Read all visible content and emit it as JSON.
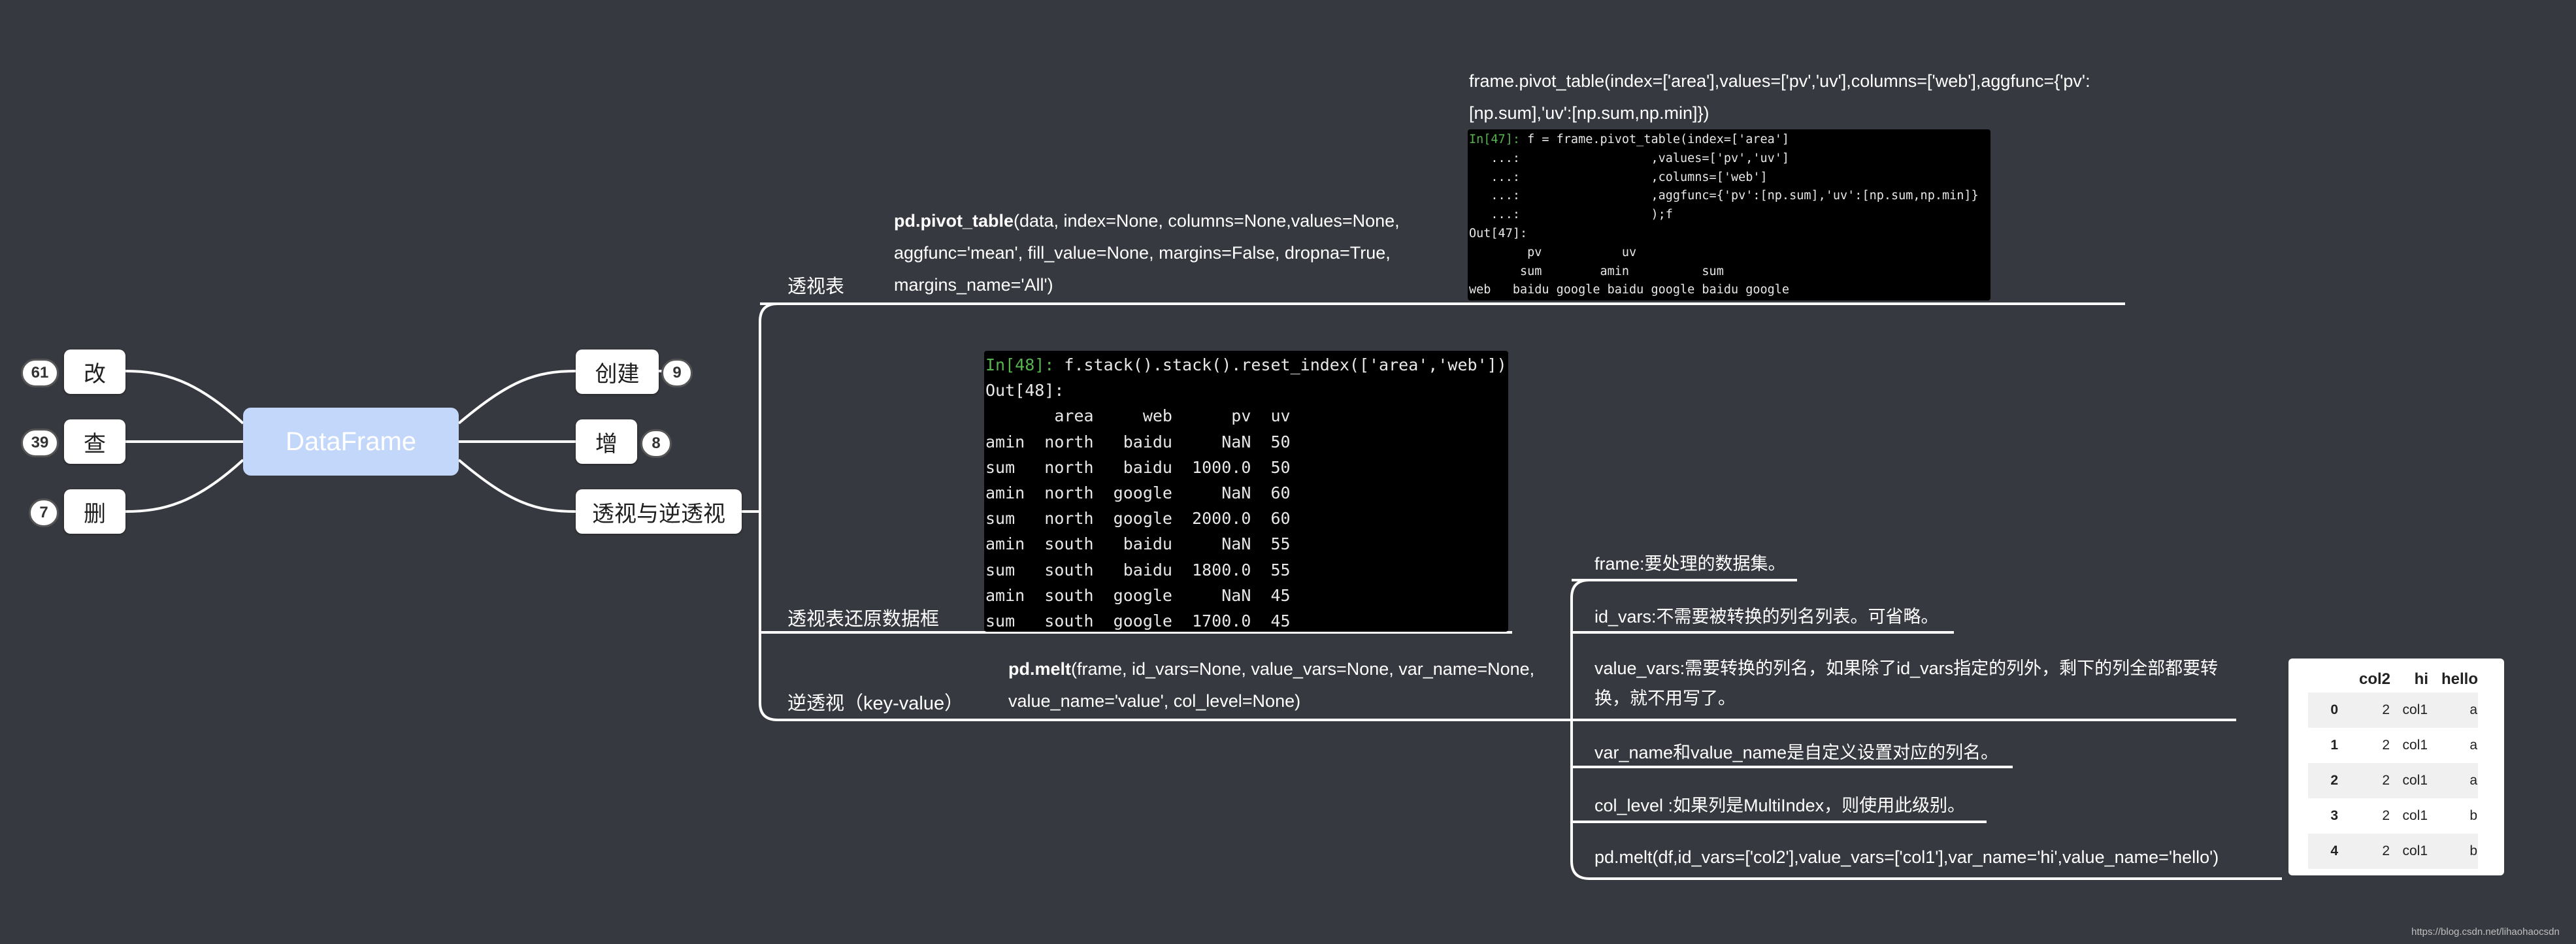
{
  "root": {
    "label": "DataFrame"
  },
  "left_nodes": [
    {
      "label": "改",
      "count": "61"
    },
    {
      "label": "查",
      "count": "39"
    },
    {
      "label": "删",
      "count": "7"
    }
  ],
  "right_nodes": [
    {
      "label": "创建",
      "count": "9"
    },
    {
      "label": "增",
      "count": "8"
    },
    {
      "label": "透视与逆透视"
    }
  ],
  "branches": {
    "pivot": "透视表",
    "restore": "透视表还原数据框",
    "melt": "逆透视（key-value）"
  },
  "pivot_text": {
    "func": "pd.pivot_table",
    "line1": "(data, index=None, columns=None,values=None,",
    "line2": "aggfunc='mean', fill_value=None, margins=False, dropna=True,",
    "line3": "margins_name='All')"
  },
  "example_call": {
    "line1": "frame.pivot_table(index=['area'],values=['pv','uv'],columns=['web'],aggfunc={'pv':",
    "line2": "[np.sum],'uv':[np.sum,np.min]})"
  },
  "code_pivot": {
    "l1_prompt": "In[47]:",
    "l1_code": " f = frame.pivot_table(index=['area']",
    "l2": "   ...:                  ,values=['pv','uv']",
    "l3": "   ...:                  ,columns=['web']",
    "l4": "   ...:                  ,aggfunc={'pv':[np.sum],'uv':[np.sum,np.min]}",
    "l5": "   ...:                  );f",
    "l6": "Out[47]:",
    "l7": "        pv           uv",
    "l8": "       sum        amin          sum",
    "l9": "web   baidu google baidu google baidu google"
  },
  "code_stack": {
    "l1_prompt": "In[48]:",
    "l1_code": " f.stack().stack().reset_index(['area','web'])",
    "l2": "Out[48]:",
    "l3": "       area     web      pv  uv",
    "rows": [
      "amin  north   baidu     NaN  50",
      "sum   north   baidu  1000.0  50",
      "amin  north  google     NaN  60",
      "sum   north  google  2000.0  60",
      "amin  south   baidu     NaN  55",
      "sum   south   baidu  1800.0  55",
      "amin  south  google     NaN  45",
      "sum   south  google  1700.0  45"
    ]
  },
  "melt_text": {
    "func": "pd.melt",
    "line1": "(frame, id_vars=None, value_vars=None, var_name=None,",
    "line2": "value_name='value', col_level=None)"
  },
  "melt_params": [
    {
      "line1": "frame:要处理的数据集。"
    },
    {
      "line1": "id_vars:不需要被转换的列名列表。可省略。"
    },
    {
      "line1": "value_vars:需要转换的列名，如果除了id_vars指定的列外，剩下的列全部都要转",
      "line2": "换，就不用写了。"
    },
    {
      "line1": "var_name和value_name是自定义设置对应的列名。"
    },
    {
      "line1": "col_level :如果列是MultiIndex，则使用此级别。"
    },
    {
      "line1": "pd.melt(df,id_vars=['col2'],value_vars=['col1'],var_name='hi',value_name='hello')"
    }
  ],
  "result_table": {
    "columns": [
      "col2",
      "hi",
      "hello"
    ],
    "rows": [
      {
        "idx": "0",
        "col2": "2",
        "hi": "col1",
        "hello": "a"
      },
      {
        "idx": "1",
        "col2": "2",
        "hi": "col1",
        "hello": "a"
      },
      {
        "idx": "2",
        "col2": "2",
        "hi": "col1",
        "hello": "a"
      },
      {
        "idx": "3",
        "col2": "2",
        "hi": "col1",
        "hello": "b"
      },
      {
        "idx": "4",
        "col2": "2",
        "hi": "col1",
        "hello": "b"
      }
    ]
  },
  "footer": "https://blog.csdn.net/lihaohaocsdn",
  "colors": {
    "background": "#36393f",
    "root": "#c3d7fb",
    "line": "#ffffff",
    "prompt": "#56b34f"
  }
}
